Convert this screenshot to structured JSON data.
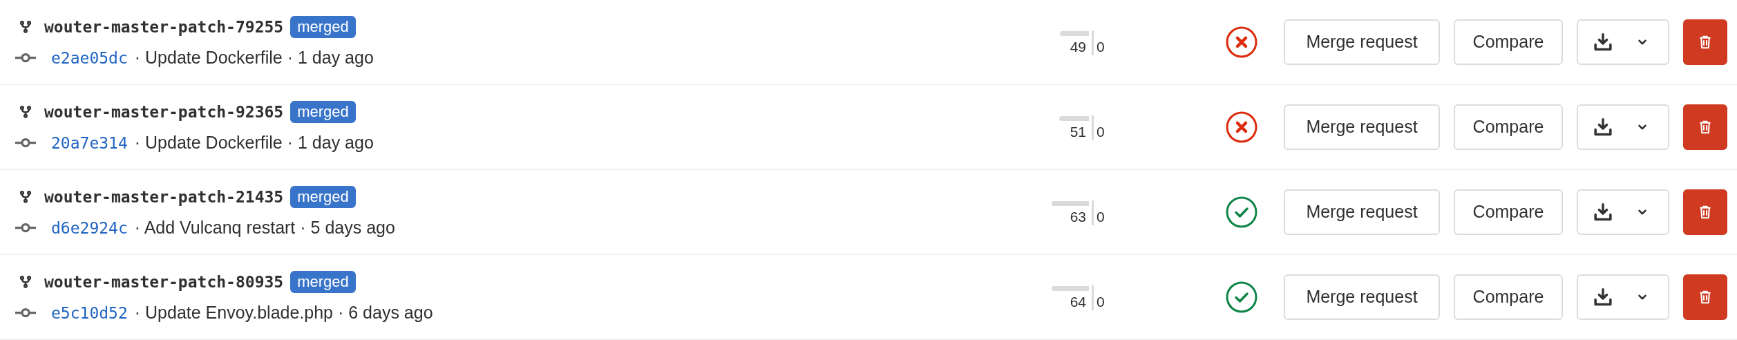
{
  "branches": [
    {
      "name": "wouter-master-patch-79255",
      "badge": "merged",
      "sha": "e2ae05dc",
      "detail": "· Update Dockerfile · 1 day ago",
      "behind": "49",
      "ahead": "0",
      "failed": true,
      "merge_button": "Merge request",
      "compare_button": "Compare"
    },
    {
      "name": "wouter-master-patch-92365",
      "badge": "merged",
      "sha": "20a7e314",
      "detail": "· Update Dockerfile · 1 day ago",
      "behind": "51",
      "ahead": "0",
      "failed": true,
      "merge_button": "Merge request",
      "compare_button": "Compare"
    },
    {
      "name": "wouter-master-patch-21435",
      "badge": "merged",
      "sha": "d6e2924c",
      "detail": "· Add Vulcanq restart · 5 days ago",
      "behind": "63",
      "ahead": "0",
      "failed": false,
      "merge_button": "Merge request",
      "compare_button": "Compare"
    },
    {
      "name": "wouter-master-patch-80935",
      "badge": "merged",
      "sha": "e5c10d52",
      "detail": "· Update Envoy.blade.php · 6 days ago",
      "behind": "64",
      "ahead": "0",
      "failed": false,
      "merge_button": "Merge request",
      "compare_button": "Compare"
    }
  ]
}
